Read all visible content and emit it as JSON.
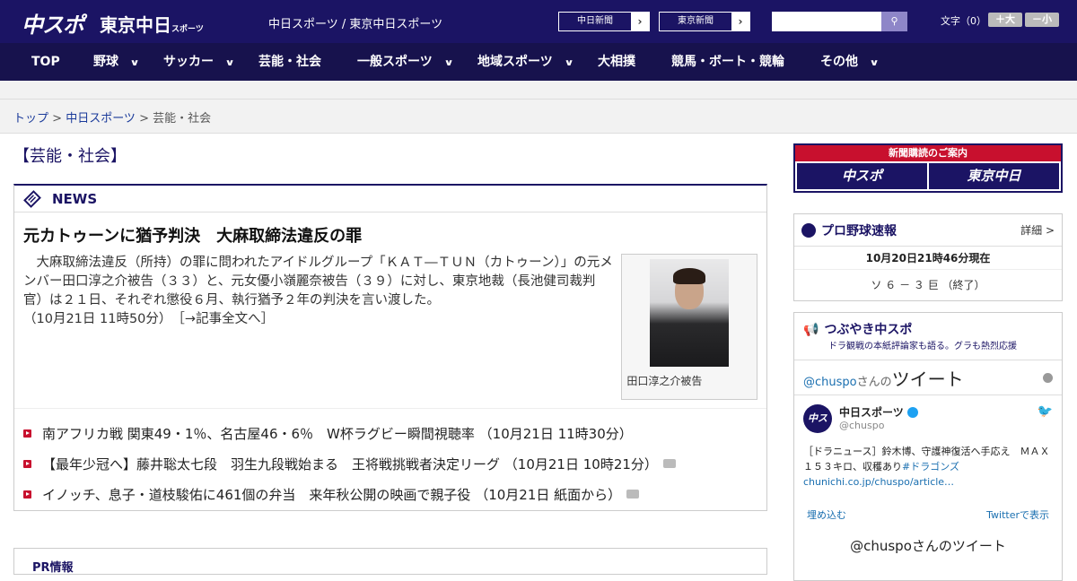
{
  "header": {
    "logo_main": "中スポ",
    "logo_tokyo": "東京中日",
    "logo_tokyo_sub": "スポーツ",
    "site_links": "中日スポーツ / 東京中日スポーツ",
    "paper_btn1": "中日新聞",
    "paper_btn2": "東京新聞",
    "search_placeholder": "",
    "font_label": "文字（0）",
    "font_up": "＋大",
    "font_down": "－小"
  },
  "nav": {
    "items": [
      {
        "label": "TOP"
      },
      {
        "label": "野球"
      },
      {
        "label": "サッカー"
      },
      {
        "label": "芸能・社会"
      },
      {
        "label": "一般スポーツ"
      },
      {
        "label": "地域スポーツ"
      },
      {
        "label": "大相撲"
      },
      {
        "label": "競馬・ボート・競輪"
      },
      {
        "label": "その他"
      }
    ]
  },
  "breadcrumb": {
    "top": "トップ",
    "section": "中日スポーツ",
    "current": "芸能・社会",
    "sep": " > "
  },
  "main": {
    "category_title": "【芸能・社会】",
    "news_label": "NEWS",
    "headline": "元カトゥーンに猶予判決　大麻取締法違反の罪",
    "body": "大麻取締法違反（所持）の罪に問われたアイドルグループ「ＫＡＴ―ＴＵＮ（カトゥーン）」の元メンバー田口淳之介被告（３３）と、元女優小嶺麗奈被告（３９）に対し、東京地裁（長池健司裁判官）は２１日、それぞれ懲役６月、執行猶予２年の判決を言い渡した。",
    "timestamp": "（10月21日 11時50分）",
    "more": "［→記事全文へ］",
    "photo_caption": "田口淳之介被告",
    "links": [
      {
        "text": "南アフリカ戦 関東49・1％、名古屋46・6％　W杯ラグビー瞬間視聴率",
        "time": "（10月21日 11時30分）",
        "has_photo": false
      },
      {
        "text": "【最年少冠へ】藤井聡太七段　羽生九段戦始まる　王将戦挑戦者決定リーグ",
        "time": "（10月21日 10時21分）",
        "has_photo": true
      },
      {
        "text": "イノッチ、息子・道枝駿佑に461個の弁当　来年秋公開の映画で親子役",
        "time": "（10月21日 紙面から）",
        "has_photo": true
      }
    ],
    "pr_label": "PR情報"
  },
  "sidebar": {
    "subscribe_title": "新聞購読のご案内",
    "subscribe_left": "中スポ",
    "subscribe_right": "東京中日",
    "baseball_title": "プロ野球速報",
    "baseball_detail": "詳細 >",
    "baseball_time": "10月20日21時46分現在",
    "baseball_score": "ソ ６ － ３ 巨 （終了）",
    "tweet_title": "つぶやき中スポ",
    "tweet_subtitle": "ドラ観戦の本紙評論家も語る。グラも熱烈応援",
    "tweet_handle_link": "@chuspo",
    "tweet_handle_suffix": "さんの",
    "tweet_word": "ツイート",
    "tweet_name": "中日スポーツ",
    "tweet_user": "@chuspo",
    "tweet_text": "［ドラニュース］鈴木博、守護神復活へ手応え　ＭＡＸ１５３キロ、収穫あり",
    "tweet_hashtag": "#ドラゴンズ",
    "tweet_link": "chunichi.co.jp/chuspo/article…",
    "embed": "埋め込む",
    "view_on_twitter": "Twitterで表示",
    "tweet_footer": "@chuspoさんのツイート"
  },
  "colors": {
    "brand": "#1b1464",
    "accent": "#c8102e"
  }
}
